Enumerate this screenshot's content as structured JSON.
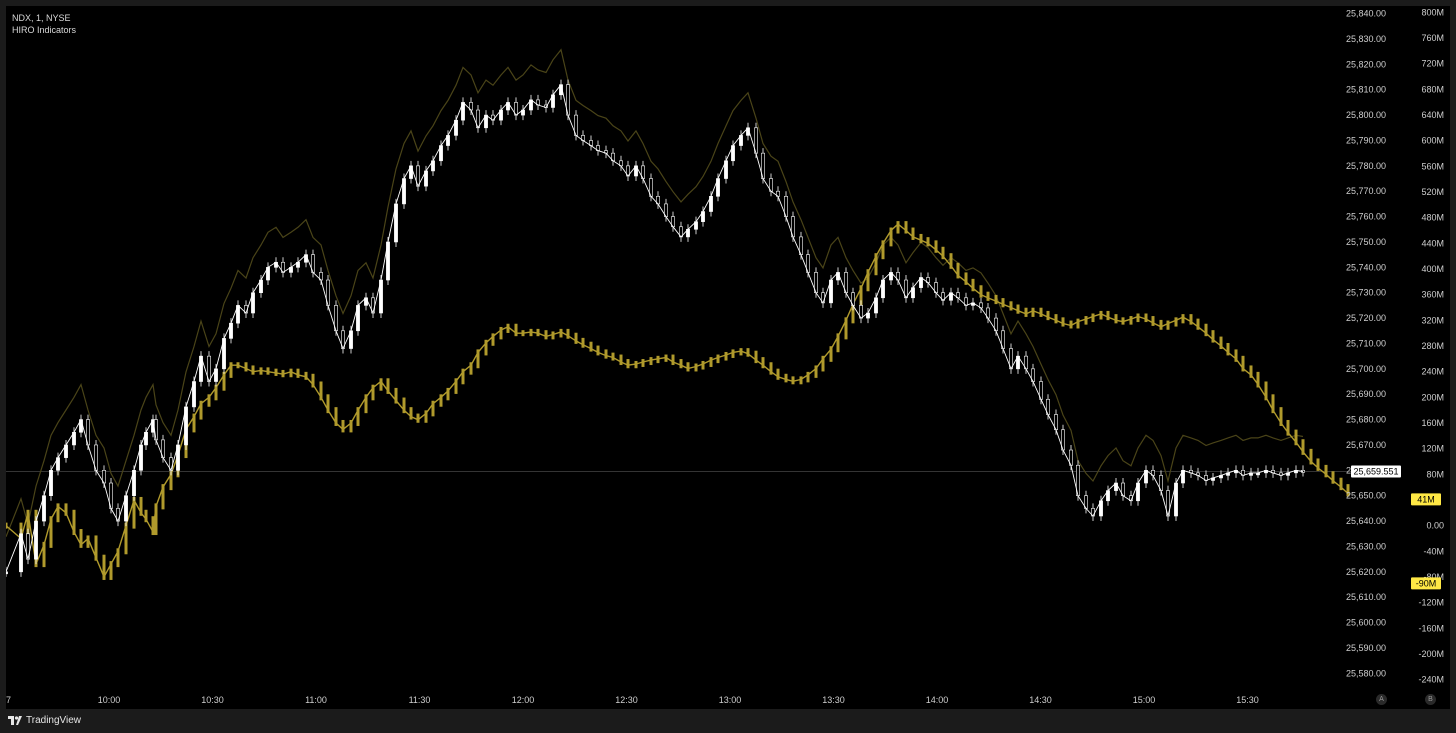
{
  "header": {
    "symbol": "NDX, 1, NYSE",
    "indicator": "HIRO Indicators"
  },
  "branding": {
    "logo_icon": "tradingview-logo-icon",
    "name": "TradingView"
  },
  "buttons": {
    "auto_label": "A",
    "scale_label": "B"
  },
  "colors": {
    "background": "#000000",
    "price": "#ffffff",
    "hiro": "#b09a2c",
    "hiro_dim": "#4a4418",
    "badge": "#ffe845"
  },
  "chart_data": {
    "type": "line",
    "title": "",
    "x": [
      "10:00",
      "10:30",
      "11:00",
      "11:30",
      "12:00",
      "12:30",
      "13:00",
      "13:30",
      "14:00",
      "14:30",
      "15:00",
      "15:30"
    ],
    "x_first_label": "7",
    "price_axis": {
      "ticks": [
        "25,840.00",
        "25,830.00",
        "25,820.00",
        "25,810.00",
        "25,800.00",
        "25,790.00",
        "25,780.00",
        "25,770.00",
        "25,760.00",
        "25,750.00",
        "25,740.00",
        "25,730.00",
        "25,720.00",
        "25,710.00",
        "25,700.00",
        "25,690.00",
        "25,680.00",
        "25,670.00",
        "25,660.00",
        "25,650.00",
        "25,640.00",
        "25,630.00",
        "25,620.00",
        "25,610.00",
        "25,600.00",
        "25,590.00",
        "25,580.00"
      ],
      "range": [
        25575,
        25843
      ],
      "last_price_label": "25,659.551",
      "last_price": 25659.551
    },
    "hiro_axis": {
      "ticks": [
        "800M",
        "760M",
        "720M",
        "680M",
        "640M",
        "600M",
        "560M",
        "520M",
        "480M",
        "440M",
        "400M",
        "360M",
        "320M",
        "280M",
        "240M",
        "200M",
        "160M",
        "120M",
        "80M",
        "41M",
        "0.00",
        "-40M",
        "-80M",
        "-90M",
        "-120M",
        "-160M",
        "-200M",
        "-240M"
      ],
      "range": [
        -250,
        810
      ],
      "badges": [
        {
          "label": "41M",
          "value": 41
        },
        {
          "label": "-90M",
          "value": -90
        }
      ]
    },
    "series": [
      {
        "name": "NDX",
        "axis": "price",
        "time": [
          0,
          15,
          22,
          30,
          38,
          45,
          52,
          60,
          68,
          75,
          82,
          90,
          98,
          105,
          112,
          120,
          128,
          135,
          140,
          147,
          150,
          157,
          165,
          172,
          180,
          188,
          195,
          203,
          210,
          218,
          225,
          232,
          240,
          247,
          255,
          262,
          270,
          277,
          285,
          292,
          300,
          307,
          315,
          322,
          330,
          337,
          345,
          352,
          360,
          367,
          375,
          382,
          390,
          398,
          405,
          412,
          420,
          427,
          435,
          442,
          450,
          457,
          465,
          472,
          480,
          487,
          495,
          502,
          510,
          517,
          525,
          532,
          540,
          547,
          555,
          562,
          570,
          577,
          585,
          592,
          600,
          607,
          615,
          622,
          630,
          637,
          645,
          652,
          660,
          667,
          675,
          682,
          690,
          697,
          705,
          712,
          720,
          727,
          735,
          742,
          750,
          757,
          765,
          772,
          780,
          787,
          795,
          802,
          810,
          817,
          825,
          832,
          840,
          847,
          855,
          862,
          870,
          877,
          885,
          892,
          900,
          907,
          915,
          922,
          930,
          937,
          945,
          952,
          960,
          967,
          975,
          982,
          990,
          997,
          1005,
          1012,
          1020,
          1027,
          1035,
          1042,
          1050,
          1057,
          1065,
          1072,
          1080,
          1087,
          1095,
          1102,
          1110,
          1117,
          1125,
          1132,
          1140,
          1147,
          1155,
          1162,
          1170,
          1177,
          1185,
          1192,
          1200,
          1207,
          1215,
          1222,
          1230,
          1237,
          1245,
          1252,
          1260,
          1267,
          1275,
          1282,
          1290,
          1297,
          1305,
          1312,
          1320,
          1327,
          1335,
          1342
        ],
        "values": [
          25620,
          25635,
          25625,
          25640,
          25650,
          25660,
          25665,
          25670,
          25675,
          25680,
          25670,
          25660,
          25655,
          25645,
          25640,
          25650,
          25660,
          25670,
          25675,
          25680,
          25672,
          25665,
          25660,
          25670,
          25685,
          25695,
          25705,
          25695,
          25700,
          25712,
          25718,
          25725,
          25722,
          25730,
          25735,
          25740,
          25742,
          25738,
          25740,
          25742,
          25745,
          25738,
          25735,
          25725,
          25715,
          25708,
          25715,
          25725,
          25728,
          25722,
          25735,
          25750,
          25765,
          25775,
          25780,
          25772,
          25778,
          25782,
          25788,
          25792,
          25798,
          25805,
          25802,
          25795,
          25800,
          25798,
          25802,
          25805,
          25800,
          25802,
          25806,
          25804,
          25803,
          25808,
          25812,
          25800,
          25792,
          25790,
          25788,
          25786,
          25785,
          25782,
          25780,
          25776,
          25780,
          25775,
          25768,
          25765,
          25760,
          25756,
          25752,
          25755,
          25758,
          25762,
          25768,
          25775,
          25782,
          25788,
          25792,
          25795,
          25785,
          25775,
          25770,
          25768,
          25760,
          25752,
          25745,
          25738,
          25730,
          25726,
          25735,
          25738,
          25730,
          25725,
          25720,
          25722,
          25728,
          25735,
          25738,
          25735,
          25728,
          25732,
          25736,
          25734,
          25730,
          25727,
          25730,
          25728,
          25725,
          25726,
          25724,
          25720,
          25715,
          25708,
          25700,
          25705,
          25700,
          25695,
          25688,
          25682,
          25676,
          25668,
          25662,
          25650,
          25645,
          25642,
          25648,
          25652,
          25655,
          25650,
          25648,
          25655,
          25660,
          25658,
          25652,
          25642,
          25655,
          25660,
          25659,
          25658,
          25656,
          25657,
          25658,
          25659,
          25660,
          25658,
          25659,
          25659,
          25660,
          25659,
          25658,
          25659,
          25660,
          25659.551
        ]
      },
      {
        "name": "HIRO",
        "axis": "hiro",
        "time": [
          0,
          15,
          22,
          30,
          38,
          45,
          52,
          60,
          68,
          75,
          82,
          90,
          98,
          105,
          112,
          120,
          128,
          135,
          140,
          147,
          150,
          157,
          165,
          172,
          180,
          188,
          195,
          203,
          210,
          218,
          225,
          232,
          240,
          247,
          255,
          262,
          270,
          277,
          285,
          292,
          300,
          307,
          315,
          322,
          330,
          337,
          345,
          352,
          360,
          367,
          375,
          382,
          390,
          398,
          405,
          412,
          420,
          427,
          435,
          442,
          450,
          457,
          465,
          472,
          480,
          487,
          495,
          502,
          510,
          517,
          525,
          532,
          540,
          547,
          555,
          562,
          570,
          577,
          585,
          592,
          600,
          607,
          615,
          622,
          630,
          637,
          645,
          652,
          660,
          667,
          675,
          682,
          690,
          697,
          705,
          712,
          720,
          727,
          735,
          742,
          750,
          757,
          765,
          772,
          780,
          787,
          795,
          802,
          810,
          817,
          825,
          832,
          840,
          847,
          855,
          862,
          870,
          877,
          885,
          892,
          900,
          907,
          915,
          922,
          930,
          937,
          945,
          952,
          960,
          967,
          975,
          982,
          990,
          997,
          1005,
          1012,
          1020,
          1027,
          1035,
          1042,
          1050,
          1057,
          1065,
          1072,
          1080,
          1087,
          1095,
          1102,
          1110,
          1117,
          1125,
          1132,
          1140,
          1147,
          1155,
          1162,
          1170,
          1177,
          1185,
          1192,
          1200,
          1207,
          1215,
          1222,
          1230,
          1237,
          1245,
          1252,
          1260,
          1267,
          1275,
          1282,
          1290,
          1297,
          1305,
          1312,
          1320,
          1327,
          1335,
          1342
        ],
        "values": [
          0,
          -20,
          20,
          -60,
          -30,
          10,
          30,
          20,
          -10,
          -30,
          -20,
          -50,
          -80,
          -60,
          -40,
          0,
          40,
          20,
          10,
          -10,
          30,
          60,
          80,
          110,
          150,
          170,
          190,
          200,
          215,
          235,
          250,
          250,
          245,
          240,
          242,
          240,
          238,
          236,
          240,
          235,
          232,
          220,
          200,
          180,
          160,
          150,
          160,
          180,
          200,
          215,
          225,
          210,
          195,
          180,
          170,
          165,
          175,
          190,
          200,
          210,
          225,
          240,
          250,
          270,
          285,
          295,
          305,
          310,
          300,
          300,
          302,
          300,
          295,
          298,
          302,
          296,
          288,
          282,
          276,
          270,
          265,
          262,
          255,
          250,
          252,
          255,
          258,
          260,
          262,
          255,
          250,
          245,
          248,
          252,
          258,
          262,
          266,
          270,
          272,
          268,
          258,
          250,
          240,
          232,
          228,
          225,
          228,
          235,
          245,
          260,
          275,
          295,
          320,
          345,
          370,
          395,
          420,
          440,
          460,
          470,
          460,
          450,
          445,
          440,
          430,
          420,
          405,
          390,
          380,
          370,
          360,
          355,
          350,
          345,
          340,
          335,
          330,
          335,
          330,
          325,
          320,
          315,
          312,
          318,
          322,
          326,
          330,
          325,
          320,
          318,
          322,
          326,
          322,
          316,
          310,
          315,
          320,
          325,
          318,
          310,
          300,
          290,
          280,
          270,
          260,
          245,
          235,
          220,
          200,
          180,
          160,
          145,
          130,
          115,
          100,
          90,
          80,
          70,
          60,
          50,
          -60,
          -140,
          41
        ]
      }
    ],
    "grid": false,
    "legend": "none"
  }
}
